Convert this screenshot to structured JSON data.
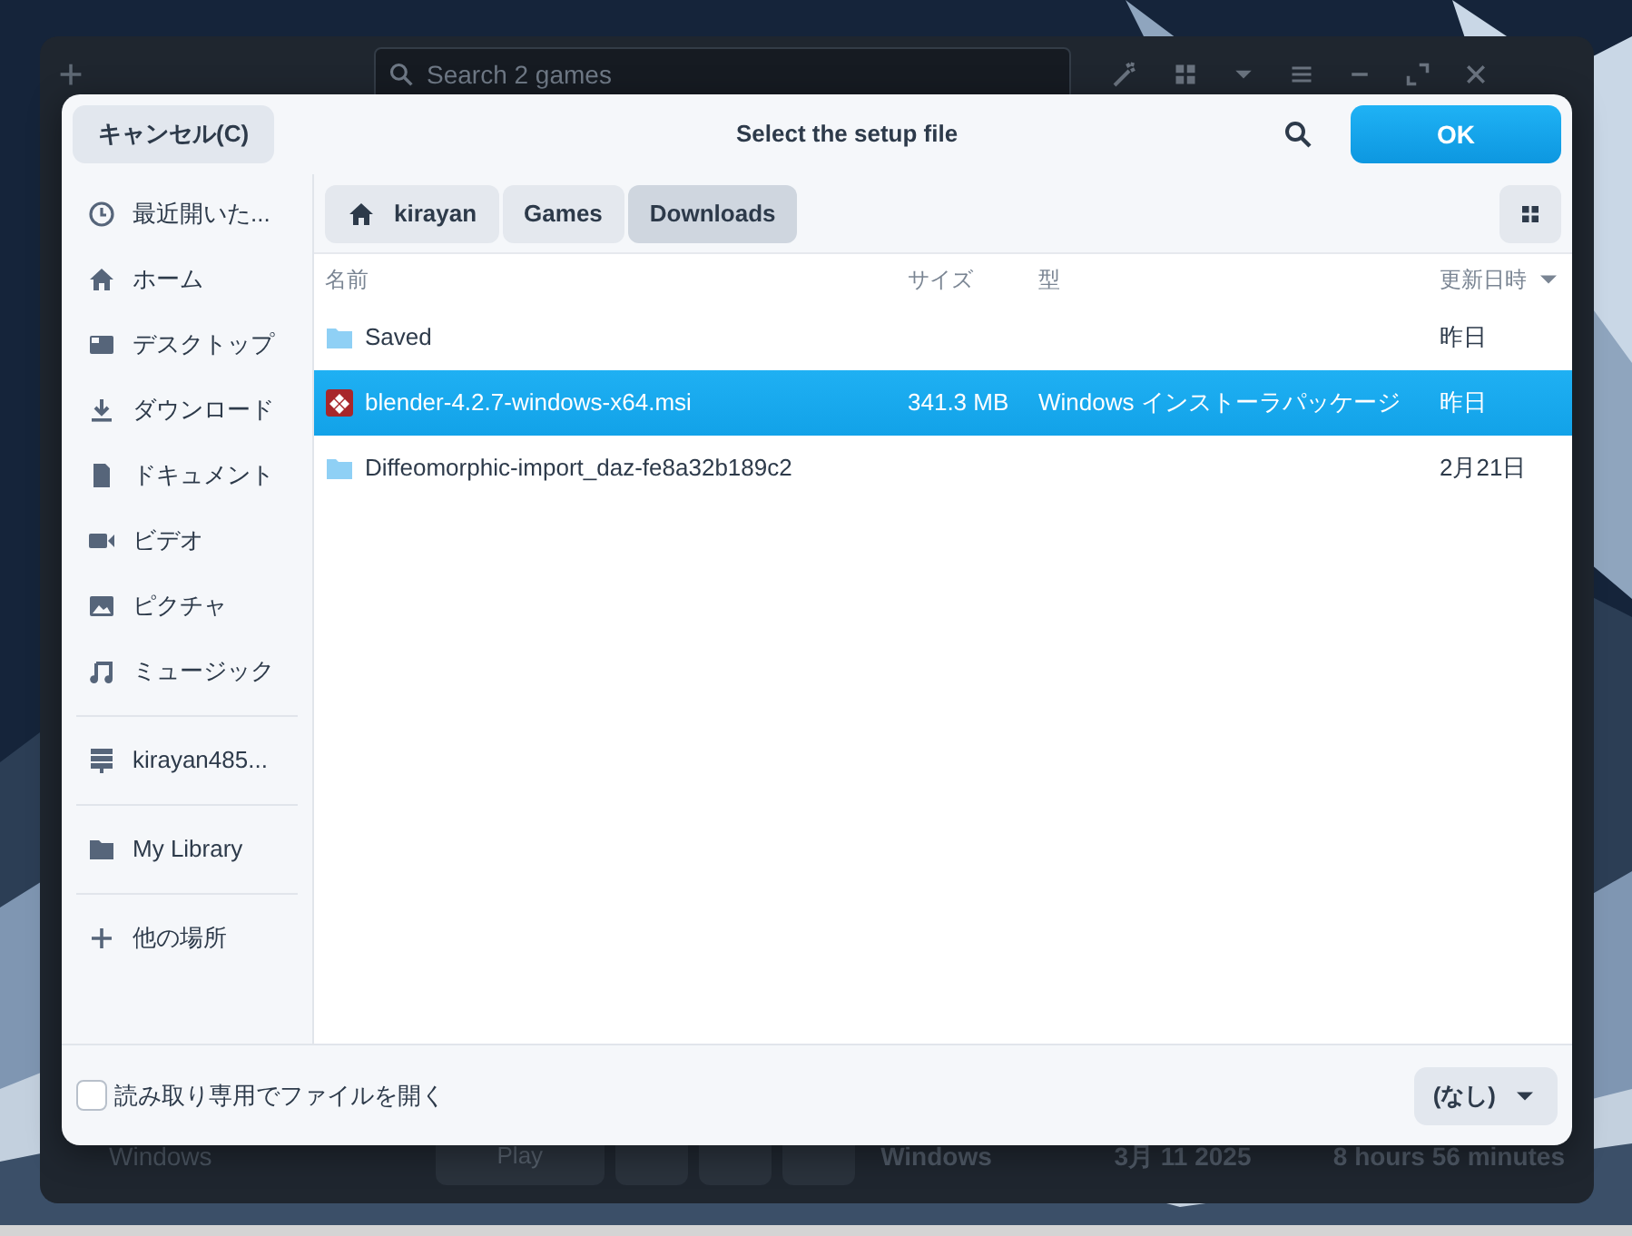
{
  "background_app": {
    "search": {
      "placeholder": "Search 2 games"
    },
    "game_row": {
      "sidebar_label": "Windows",
      "play_button": "Play",
      "platform": "Windows",
      "date": "3月 11 2025",
      "playtime": "8 hours 56 minutes"
    }
  },
  "dialog": {
    "cancel_button": "キャンセル(C)",
    "title": "Select the setup file",
    "ok_button": "OK",
    "sidebar": {
      "groups": [
        [
          {
            "label": "最近開いた...",
            "kind": "clock"
          },
          {
            "label": "ホーム",
            "kind": "home"
          },
          {
            "label": "デスクトップ",
            "kind": "desktop"
          },
          {
            "label": "ダウンロード",
            "kind": "download"
          },
          {
            "label": "ドキュメント",
            "kind": "document"
          },
          {
            "label": "ビデオ",
            "kind": "video"
          },
          {
            "label": "ピクチャ"
          },
          {
            "label": "ミュージック",
            "kind": "music"
          }
        ],
        [
          {
            "label": "kirayan485...",
            "kind": "server"
          }
        ],
        [
          {
            "label": "My Library",
            "kind": "folder"
          }
        ],
        [
          {
            "label": "他の場所",
            "kind": "plus"
          }
        ]
      ]
    },
    "path": [
      {
        "label": "kirayan",
        "kind": "home",
        "selected": false
      },
      {
        "label": "Games",
        "kind": "folder",
        "selected": false
      },
      {
        "label": "Downloads",
        "kind": "folder",
        "selected": true
      }
    ],
    "columns": [
      {
        "label": "名前",
        "sorted": false
      },
      {
        "label": "サイズ",
        "sorted": false
      },
      {
        "label": "型",
        "sorted": false
      },
      {
        "label": "更新日時",
        "sorted": true
      }
    ],
    "rows": [
      {
        "kind": "folder",
        "name": "Saved",
        "modified": "昨日",
        "selected": false
      },
      {
        "kind": "package",
        "name": "blender-4.2.7-windows-x64.msi",
        "size": "341.3 MB",
        "type": "Windows インストーラパッケージ",
        "modified": "昨日",
        "selected": true
      },
      {
        "kind": "folder",
        "name": "Diffeomorphic-import_daz-fe8a32b189c2",
        "modified": "2月21日",
        "selected": false
      }
    ],
    "read_only": {
      "label": "読み取り専用でファイルを開く",
      "checked": false
    },
    "filter": "(なし)"
  }
}
